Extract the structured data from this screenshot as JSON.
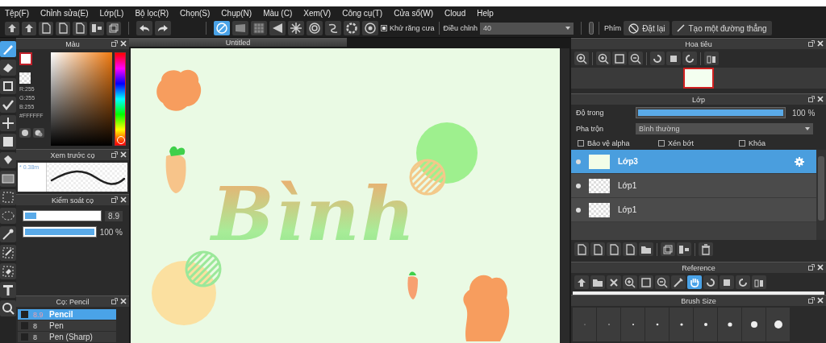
{
  "menu": [
    "Tệp(F)",
    "Chỉnh sửa(E)",
    "Lớp(L)",
    "Bộ lọc(R)",
    "Chọn(S)",
    "Chụp(N)",
    "Màu (C)",
    "Xem(V)",
    "Công cụ(T)",
    "Cửa sổ(W)",
    "Cloud",
    "Help"
  ],
  "toolbar": {
    "snaps": [
      {
        "selected": true
      },
      {
        "selected": false
      },
      {
        "selected": false
      },
      {
        "selected": false
      },
      {
        "selected": false
      },
      {
        "selected": false
      },
      {
        "selected": false
      },
      {
        "selected": false
      },
      {
        "selected": false
      }
    ],
    "antialias": {
      "label": "Khử răng cưa",
      "checked": true
    },
    "adjust": {
      "label": "Điều chỉnh",
      "value": "40"
    },
    "keys_label": "Phím",
    "reset_button": "Đặt lại",
    "line_button": "Tạo một đường thẳng"
  },
  "tools": [
    {
      "kind": "brush",
      "selected": true
    },
    {
      "kind": "eraser",
      "selected": false
    },
    {
      "kind": "rect",
      "selected": false
    },
    {
      "kind": "check",
      "selected": false
    },
    {
      "kind": "move",
      "selected": false
    },
    {
      "kind": "fill",
      "selected": false
    },
    {
      "kind": "bucket",
      "selected": false
    },
    {
      "kind": "gradient",
      "selected": false
    },
    {
      "kind": "select",
      "selected": false
    },
    {
      "kind": "lasso",
      "selected": false
    },
    {
      "kind": "wand",
      "selected": false
    },
    {
      "kind": "selpen",
      "selected": false
    },
    {
      "kind": "selerase",
      "selected": false
    },
    {
      "kind": "text",
      "selected": false
    },
    {
      "kind": "zoom",
      "selected": false
    }
  ],
  "color_panel": {
    "title": "Màu",
    "hue": {
      "level": 0
    },
    "r": "R:255",
    "g": "G:255",
    "b": "B:255",
    "hex": "#FFFFFF"
  },
  "brush_preview": {
    "title": "Xem trước cọ",
    "size": "* 0.38m"
  },
  "brush_control": {
    "title": "Kiểm soát cọ",
    "size": {
      "level": 0.15,
      "reading": "8.9"
    },
    "opacity": {
      "level": 1,
      "reading": "100 %"
    }
  },
  "brush_list": {
    "title": "Cọ: Pencil",
    "items": [
      {
        "size": "8.9",
        "name": "Pencil",
        "selected": true
      },
      {
        "size": "8",
        "name": "Pen",
        "selected": false
      },
      {
        "size": "8",
        "name": "Pen (Sharp)",
        "selected": false
      }
    ]
  },
  "canvas": {
    "tab": "Untitled",
    "text": "Bình"
  },
  "navigator": {
    "title": "Hoa tiêu"
  },
  "layers": {
    "title": "Lớp",
    "opacity": {
      "label": "Độ trong",
      "level": 1,
      "reading": "100 %"
    },
    "blend": {
      "label": "Pha trộn",
      "value": "Bình thường"
    },
    "options": [
      {
        "label": "Bảo vệ alpha",
        "checked": false
      },
      {
        "label": "Xén bớt",
        "checked": false
      },
      {
        "label": "Khóa",
        "checked": false
      }
    ],
    "items": [
      {
        "name": "Lớp3",
        "selected": true
      },
      {
        "name": "Lớp1",
        "selected": false
      },
      {
        "name": "Lớp1",
        "selected": false
      }
    ]
  },
  "reference": {
    "title": "Reference",
    "tools": [
      {
        "selected": false
      },
      {
        "selected": false
      },
      {
        "selected": false
      },
      {
        "selected": false
      },
      {
        "selected": false
      },
      {
        "selected": false
      },
      {
        "selected": false
      },
      {
        "selected": true
      },
      {
        "selected": false
      },
      {
        "selected": false
      },
      {
        "selected": false
      },
      {
        "selected": false
      }
    ]
  },
  "brush_size": {
    "title": "Brush Size"
  }
}
